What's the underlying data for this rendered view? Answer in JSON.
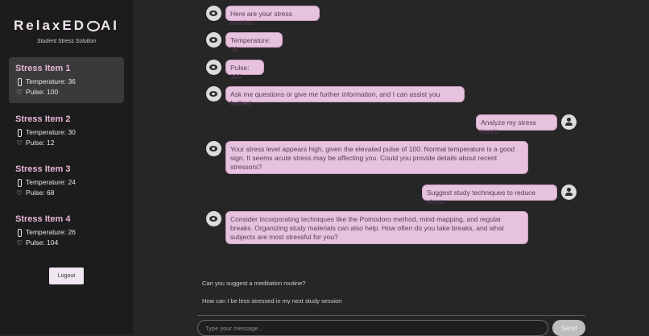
{
  "brand": {
    "name_part1": "RelaxED",
    "name_part2": "AI",
    "tagline": "Student Stress Solution"
  },
  "sidebar": {
    "items": [
      {
        "title": "Stress Item 1",
        "temperature": "Temperature: 36",
        "pulse": "Pulse: 100"
      },
      {
        "title": "Stress Item 2",
        "temperature": "Temperature: 30",
        "pulse": "Pulse: 12"
      },
      {
        "title": "Stress Item 3",
        "temperature": "Temperature: 24",
        "pulse": "Pulse: 68"
      },
      {
        "title": "Stress Item 4",
        "temperature": "Temperature: 26",
        "pulse": "Pulse: 104"
      }
    ],
    "logout_label": "Logout"
  },
  "chat": {
    "messages": [
      {
        "sender": "bot",
        "text": "Here are your stress metrics:"
      },
      {
        "sender": "bot",
        "text": "Temperature: 36"
      },
      {
        "sender": "bot",
        "text": "Pulse: 100"
      },
      {
        "sender": "bot",
        "text": "Ask me questions or give me further information, and I can assist you further!"
      },
      {
        "sender": "user",
        "text": "Analyze my stress levels"
      },
      {
        "sender": "bot",
        "text": "Your stress level appears high, given the elevated pulse of 100. Normal temperature is a good sign. It seems acute stress may be affecting you. Could you provide details about recent stressors?"
      },
      {
        "sender": "user",
        "text": "Suggest study techniques to reduce stress"
      },
      {
        "sender": "bot",
        "text": "Consider incorporating techniques like the Pomodoro method, mind mapping, and regular breaks. Organizing study materials can also help. How often do you take breaks, and what subjects are most stressful for you?"
      }
    ],
    "suggestions": [
      "Can you suggest a meditation routine?",
      "How can I be less stressed in my next study session"
    ],
    "input_placeholder": "Type your message...",
    "send_label": "Send"
  }
}
